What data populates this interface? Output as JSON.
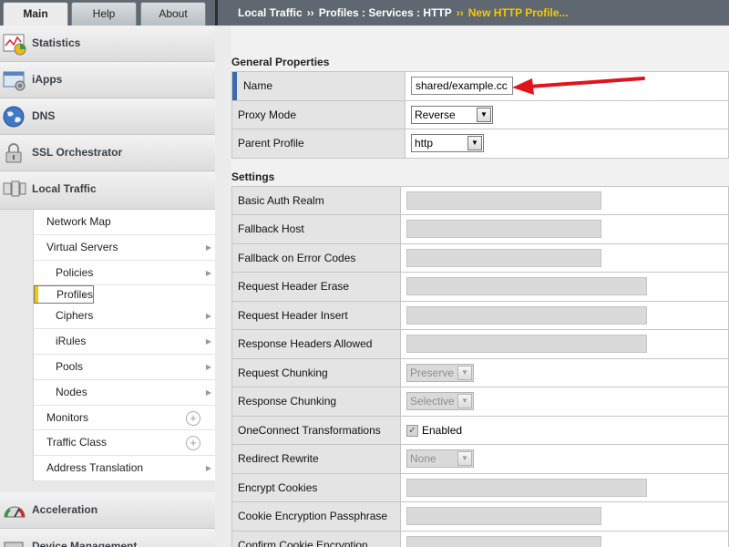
{
  "tabs": {
    "main": "Main",
    "help": "Help",
    "about": "About"
  },
  "nav": {
    "statistics": "Statistics",
    "iapps": "iApps",
    "dns": "DNS",
    "ssl": "SSL Orchestrator",
    "local_traffic": "Local Traffic",
    "items": [
      {
        "label": "Network Map"
      },
      {
        "label": "Virtual Servers"
      },
      {
        "label": "Policies"
      },
      {
        "label": "Profiles"
      },
      {
        "label": "Ciphers"
      },
      {
        "label": "iRules"
      },
      {
        "label": "Pools"
      },
      {
        "label": "Nodes"
      },
      {
        "label": "Monitors"
      },
      {
        "label": "Traffic Class"
      },
      {
        "label": "Address Translation"
      }
    ],
    "acceleration": "Acceleration",
    "device_management": "Device Management"
  },
  "breadcrumb": {
    "part1": "Local Traffic",
    "sep": "››",
    "part2": "Profiles : Services : HTTP",
    "sep2": "››",
    "current": "New HTTP Profile..."
  },
  "general": {
    "heading": "General Properties",
    "name_label": "Name",
    "name_value": "shared/example.cc",
    "proxy_label": "Proxy Mode",
    "proxy_value": "Reverse",
    "parent_label": "Parent Profile",
    "parent_value": "http"
  },
  "settings": {
    "heading": "Settings",
    "rows": {
      "basic_auth": "Basic Auth Realm",
      "fallback_host": "Fallback Host",
      "fallback_codes": "Fallback on Error Codes",
      "req_erase": "Request Header Erase",
      "req_insert": "Request Header Insert",
      "resp_allowed": "Response Headers Allowed",
      "req_chunk": "Request Chunking",
      "req_chunk_value": "Preserve",
      "resp_chunk": "Response Chunking",
      "resp_chunk_value": "Selective",
      "oneconnect": "OneConnect Transformations",
      "oneconnect_value": "Enabled",
      "redirect": "Redirect Rewrite",
      "redirect_value": "None",
      "encrypt_cookies": "Encrypt Cookies",
      "cookie_pass": "Cookie Encryption Passphrase",
      "confirm_cookie": "Confirm Cookie Encryption"
    }
  },
  "colors": {
    "accent": "#f4c500",
    "header": "#5f6870",
    "annotation_arrow": "#e0141a"
  }
}
